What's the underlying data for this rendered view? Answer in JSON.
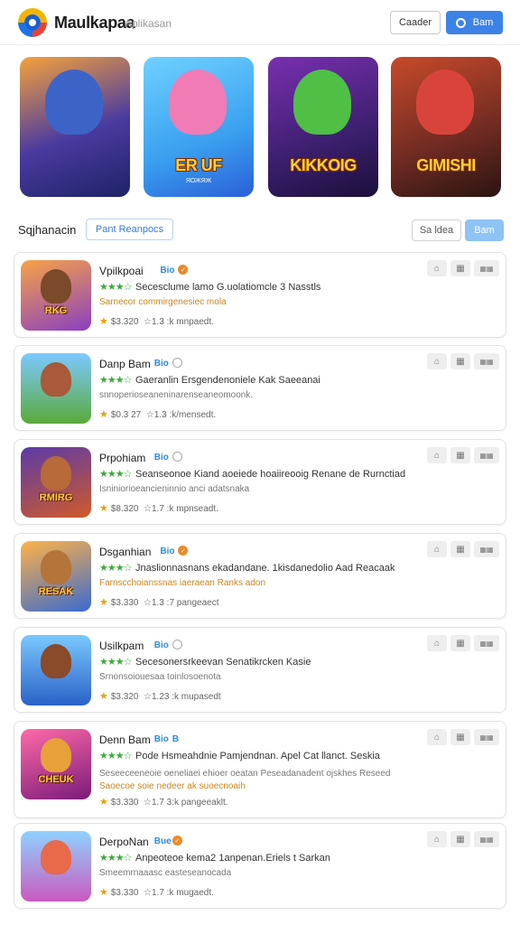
{
  "header": {
    "title": "Maulkapaa",
    "subtitle": "Aplikasan",
    "btn_outline": "Caader",
    "btn_primary": "Bam",
    "search_icon": "search-icon"
  },
  "featured": [
    {
      "title": "",
      "sub": "",
      "bg": "linear-gradient(160deg,#f6a23a 0%,#4a3aa0 55%,#1e2366 100%)",
      "figure": "#3c64c8"
    },
    {
      "title": "ER UF",
      "sub": "ЯОЖЯЖ",
      "bg": "linear-gradient(160deg,#6fd1ff 0%,#3aa0f0 60%,#2b5fd8 100%)",
      "figure": "#f07bb5"
    },
    {
      "title": "KIKKOIG",
      "sub": "",
      "bg": "linear-gradient(160deg,#7a2fb0 0%,#3b1f6e 60%,#1b0f3a 100%)",
      "figure": "#4fbf46"
    },
    {
      "title": "GIMISHI",
      "sub": "",
      "bg": "linear-gradient(160deg,#c74a2a 0%,#6e2a22 60%,#2a1412 100%)",
      "figure": "#d8443b"
    }
  ],
  "section": {
    "title": "Sqjhanacin",
    "chip": "Pant Reanpocs",
    "sort_outline": "Sa ldea",
    "sort_primary": "Bam"
  },
  "apps": [
    {
      "name": "Vpilkpoai",
      "tag": "Bio",
      "badge": "orange",
      "desc1": "Secesclume lamo G.uolatiomcle 3 Nasstls",
      "desc2": "Sarnecor commirgenesiec mola",
      "desc2_warm": true,
      "rating": "$3.320",
      "downloads": "☆1.3 :k  mnpaedt.",
      "bg": "linear-gradient(160deg,#f7a346,#8a3fc0)",
      "figure": "#7b4a2a",
      "thumb_text": "RKG"
    },
    {
      "name": "Danp Bam",
      "tag": "Bio",
      "badge": "ghost",
      "desc1": "Gaeranlin Ersgendenoniele Kak Saeeanai",
      "desc2": "snnoperioseaneninarenseaneomoonk.",
      "desc2_warm": false,
      "rating": "$0.3 27",
      "downloads": "☆1.3 :k/mensedt.",
      "bg": "linear-gradient(180deg,#7cc9ff,#5aaa3a)",
      "figure": "#a85a3a",
      "thumb_text": ""
    },
    {
      "name": "Prpohiam",
      "tag": "Bio",
      "badge": "ghost",
      "desc1": "Seanseonoe Kiand aoeiede hoaiireooig Renane de Rurnctiad",
      "desc2": "Isniniorioeancieninnio anci adatsnaka",
      "desc2_warm": false,
      "rating": "$8.320",
      "downloads": "☆1.7 :k  mpnseadt.",
      "bg": "linear-gradient(160deg,#5a3aa8,#d05a2a)",
      "figure": "#b86a3a",
      "thumb_text": "RMIRG"
    },
    {
      "name": "Dsganhian",
      "tag": "Bio",
      "badge": "orange",
      "desc1": "Jnaslionnasnans ekadandane. 1kisdanedolio Aad Reacaak",
      "desc2": "Farnscchoianssnas iaeraean Ranks adon",
      "desc2_warm": true,
      "rating": "$3.330",
      "downloads": "☆1.3 :7 pangeaect",
      "bg": "linear-gradient(160deg,#ffb347,#3a6ad0)",
      "figure": "#b4743a",
      "thumb_text": "RESAK"
    },
    {
      "name": "Usilkpam",
      "tag": "Bio",
      "badge": "ghost",
      "desc1": "Secesonersrkeevan Senatikrcken Kasie",
      "desc2": "Srnonsoiouesaa toinlosoenota",
      "desc2_warm": false,
      "rating": "$3.320",
      "downloads": "☆1.23 :k  mupasedt",
      "bg": "linear-gradient(180deg,#7bc8ff,#2a62c8)",
      "figure": "#8b4a2a",
      "thumb_text": ""
    },
    {
      "name": "Denn Bam",
      "tag": "Bio",
      "badge": "text",
      "desc1": "Pode Hsmeahdnie Pamjendnan. Apel Cat llanct. Seskia",
      "desc2": "Seseeceeneoie oeneliaei ehioer oeatan Peseadanadent ojskhes Reseed",
      "desc2_warm": false,
      "desc3": "Saoecoe soie nedeer ak suoecnoaih",
      "rating": "$3.330",
      "downloads": "☆1.7 3:k  pangeeaklt.",
      "bg": "linear-gradient(160deg,#ff6aa8,#7a1a7a)",
      "figure": "#e8a13a",
      "thumb_text": "CHEUK"
    },
    {
      "name": "DerpoNan",
      "tag": "Bue",
      "badge": "orange",
      "desc1": "Anpeoteoe kema2 1anpenan.Eriels t Sarkan",
      "desc2": "Smeemrnaaasc easteseanocada",
      "desc2_warm": false,
      "rating": "$3.330",
      "downloads": "☆1.7 :k  mugaedt.",
      "bg": "linear-gradient(180deg,#8fd2ff,#c95ac0)",
      "figure": "#e86a4a",
      "thumb_text": ""
    }
  ]
}
